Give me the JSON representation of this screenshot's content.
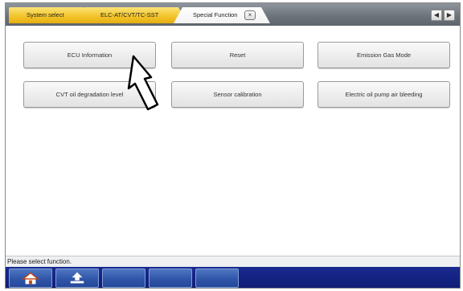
{
  "tabs": {
    "system_select": "System select",
    "elc": "ELC-AT/CVT/TC-SST",
    "special_function": "Special Function",
    "close_glyph": "×"
  },
  "nav": {
    "prev_glyph": "◀",
    "next_glyph": "▶"
  },
  "functions": [
    {
      "label": "ECU Information"
    },
    {
      "label": "Reset"
    },
    {
      "label": "Emission Gas Mode"
    },
    {
      "label": "CVT oil degradation level"
    },
    {
      "label": "Sensor calibration"
    },
    {
      "label": "Electric oil pump air bleeding"
    }
  ],
  "status": {
    "text": "Please select function."
  },
  "toolbar": {
    "buttons": [
      {
        "icon": "home-icon"
      },
      {
        "icon": "back-arrow-icon"
      },
      {
        "icon": ""
      },
      {
        "icon": ""
      },
      {
        "icon": ""
      }
    ]
  },
  "colors": {
    "tab_yellow": "#f3c52c",
    "toolbar_blue": "#0e1c74",
    "toolbar_button": "#2f56a8"
  }
}
